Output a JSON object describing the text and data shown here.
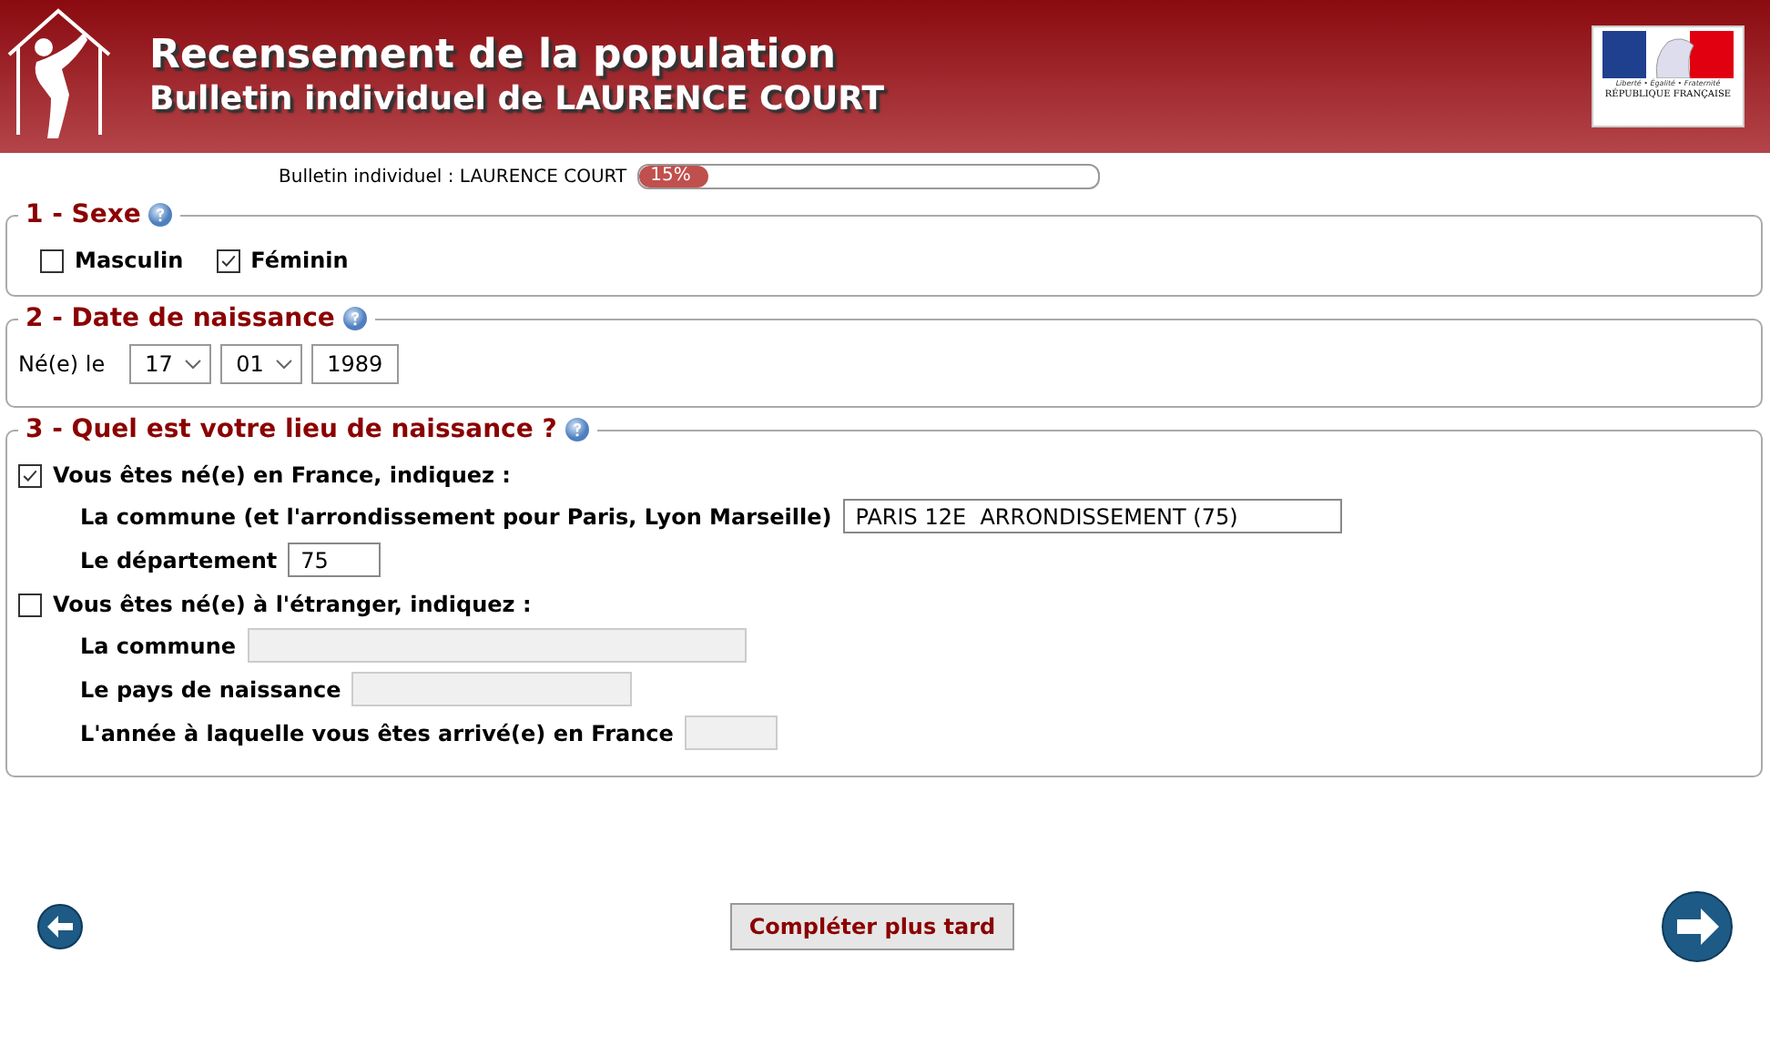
{
  "header": {
    "title": "Recensement de la population",
    "subtitle": "Bulletin individuel de LAURENCE COURT",
    "emblem": {
      "motto": "Liberté • Égalité • Fraternité",
      "name": "RÉPUBLIQUE FRANÇAISE"
    }
  },
  "progress": {
    "label": "Bulletin individuel : LAURENCE COURT",
    "reading": "15%",
    "level": 0.15
  },
  "sexe": {
    "title": "1 - Sexe",
    "options": [
      {
        "label": "Masculin",
        "checked": false
      },
      {
        "label": "Féminin",
        "checked": true
      }
    ]
  },
  "birth_date": {
    "title": "2 - Date de naissance",
    "label": "Né(e) le",
    "day": "17",
    "month": "01",
    "year": "1989"
  },
  "birthplace": {
    "title": "3 - Quel est votre lieu de naissance ?",
    "groups": [
      {
        "label": "Vous êtes né(e) en France, indiquez :",
        "checked": true,
        "fields": [
          {
            "label": "La commune (et l'arrondissement pour Paris, Lyon Marseille)",
            "value": "PARIS 12E  ARRONDISSEMENT (75)",
            "disabled": false
          },
          {
            "label": "Le département",
            "value": "75",
            "disabled": false
          }
        ]
      },
      {
        "label": "Vous êtes né(e) à l'étranger, indiquez :",
        "checked": false,
        "fields": [
          {
            "label": "La commune",
            "disabled": true
          },
          {
            "label": "Le pays de naissance",
            "disabled": true
          },
          {
            "label": "L'année à laquelle vous êtes arrivé(e) en France",
            "disabled": true
          }
        ]
      }
    ]
  },
  "later_button": "Compléter plus tard"
}
